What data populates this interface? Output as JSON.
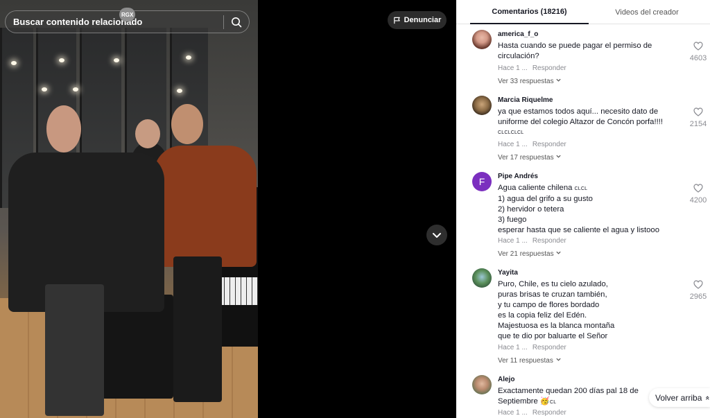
{
  "search": {
    "placeholder": "Buscar contenido relacionado",
    "badge": "RGX"
  },
  "report_label": "Denunciar",
  "tabs": [
    {
      "label": "Comentarios (18216)",
      "active": true
    },
    {
      "label": "Videos del creador",
      "active": false
    }
  ],
  "comments": [
    {
      "user": "america_f_o",
      "lines": [
        "Hasta cuando se puede pagar el permiso de",
        "circulación?"
      ],
      "time": "Hace 1 ...",
      "reply": "Responder",
      "more": "Ver 33 respuestas",
      "likes": "4603"
    },
    {
      "user": "Marcia Riquelme",
      "lines": [
        "ya que estamos todos aquí... necesito dato de",
        "uniforme del colegio Altazor de Concón porfa!!!!"
      ],
      "tag_line": "CLCLCLCL",
      "time": "Hace 1 ...",
      "reply": "Responder",
      "more": "Ver 17 respuestas",
      "likes": "2154"
    },
    {
      "user": "Pipe Andrés",
      "avatar_letter": "F",
      "first_line": "Agua caliente chilena",
      "first_tag": "CLCL",
      "lines": [
        "1) agua del grifo a su gusto",
        "2) hervidor o tetera",
        "3) fuego",
        "esperar hasta que se caliente el agua y listooo"
      ],
      "time": "Hace 1 ...",
      "reply": "Responder",
      "more": "Ver 21 respuestas",
      "likes": "4200"
    },
    {
      "user": "Yayita",
      "lines": [
        "Puro, Chile, es tu cielo azulado,",
        "puras brisas te cruzan también,",
        "y tu campo de flores bordado",
        "es la copia feliz del Edén.",
        "Majestuosa es la blanca montaña",
        "que te dio por baluarte el Señor"
      ],
      "time": "Hace 1 ...",
      "reply": "Responder",
      "more": "Ver 11 respuestas",
      "likes": "2965"
    },
    {
      "user": "Alejo",
      "lines": [
        "Exactamente quedan 200 días pal 18 de"
      ],
      "last_line": "Septiembre",
      "last_tag": "CL",
      "time": "Hace 1 ...",
      "reply": "Responder"
    }
  ],
  "back_to_top": "Volver arriba",
  "colors": {
    "panel_bg": "#ffffff",
    "text": "#161823",
    "muted": "#8a8b91",
    "avatar_purple": "#7b2fbf"
  }
}
